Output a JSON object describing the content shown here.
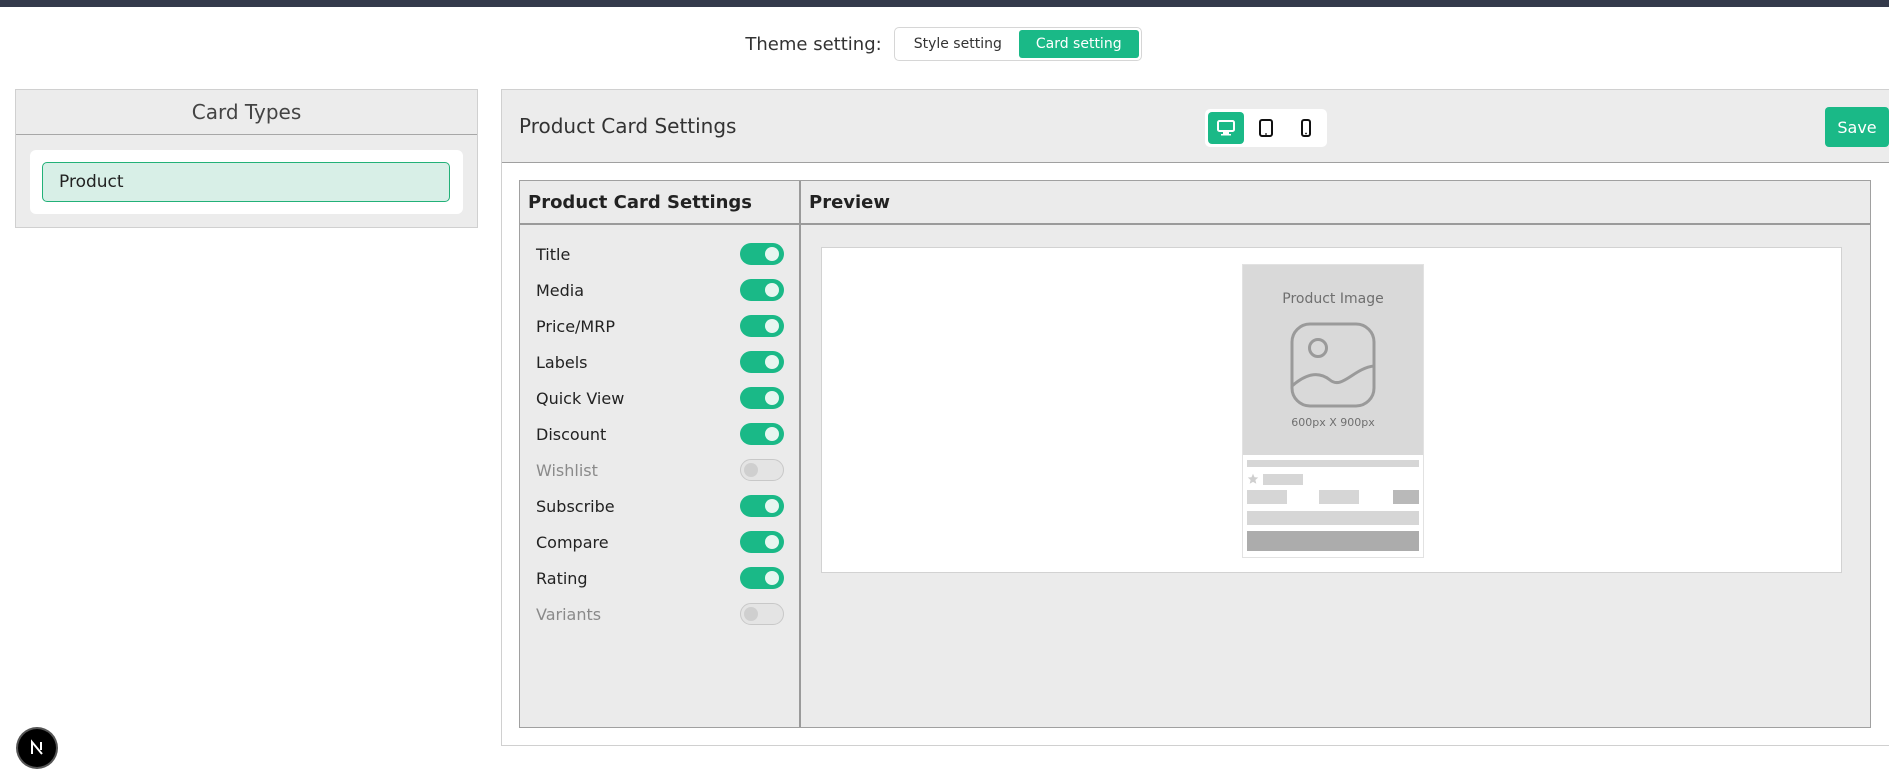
{
  "theme": {
    "label": "Theme setting:",
    "options": [
      {
        "label": "Style setting",
        "active": false
      },
      {
        "label": "Card setting",
        "active": true
      }
    ]
  },
  "card_types": {
    "title": "Card Types",
    "items": [
      {
        "label": "Product",
        "selected": true
      }
    ]
  },
  "header": {
    "title": "Product Card Settings",
    "devices": [
      {
        "name": "desktop-icon",
        "active": true
      },
      {
        "name": "tablet-icon",
        "active": false
      },
      {
        "name": "mobile-icon",
        "active": false
      }
    ],
    "save_label": "Save"
  },
  "settings": {
    "title": "Product Card Settings",
    "toggles": [
      {
        "label": "Title",
        "on": true
      },
      {
        "label": "Media",
        "on": true
      },
      {
        "label": "Price/MRP",
        "on": true
      },
      {
        "label": "Labels",
        "on": true
      },
      {
        "label": "Quick View",
        "on": true
      },
      {
        "label": "Discount",
        "on": true
      },
      {
        "label": "Wishlist",
        "on": false
      },
      {
        "label": "Subscribe",
        "on": true
      },
      {
        "label": "Compare",
        "on": true
      },
      {
        "label": "Rating",
        "on": true
      },
      {
        "label": "Variants",
        "on": false
      }
    ]
  },
  "preview": {
    "title": "Preview",
    "image_label": "Product Image",
    "image_size": "600px X 900px"
  },
  "colors": {
    "accent": "#1ab987",
    "topbar": "#343a4b"
  }
}
